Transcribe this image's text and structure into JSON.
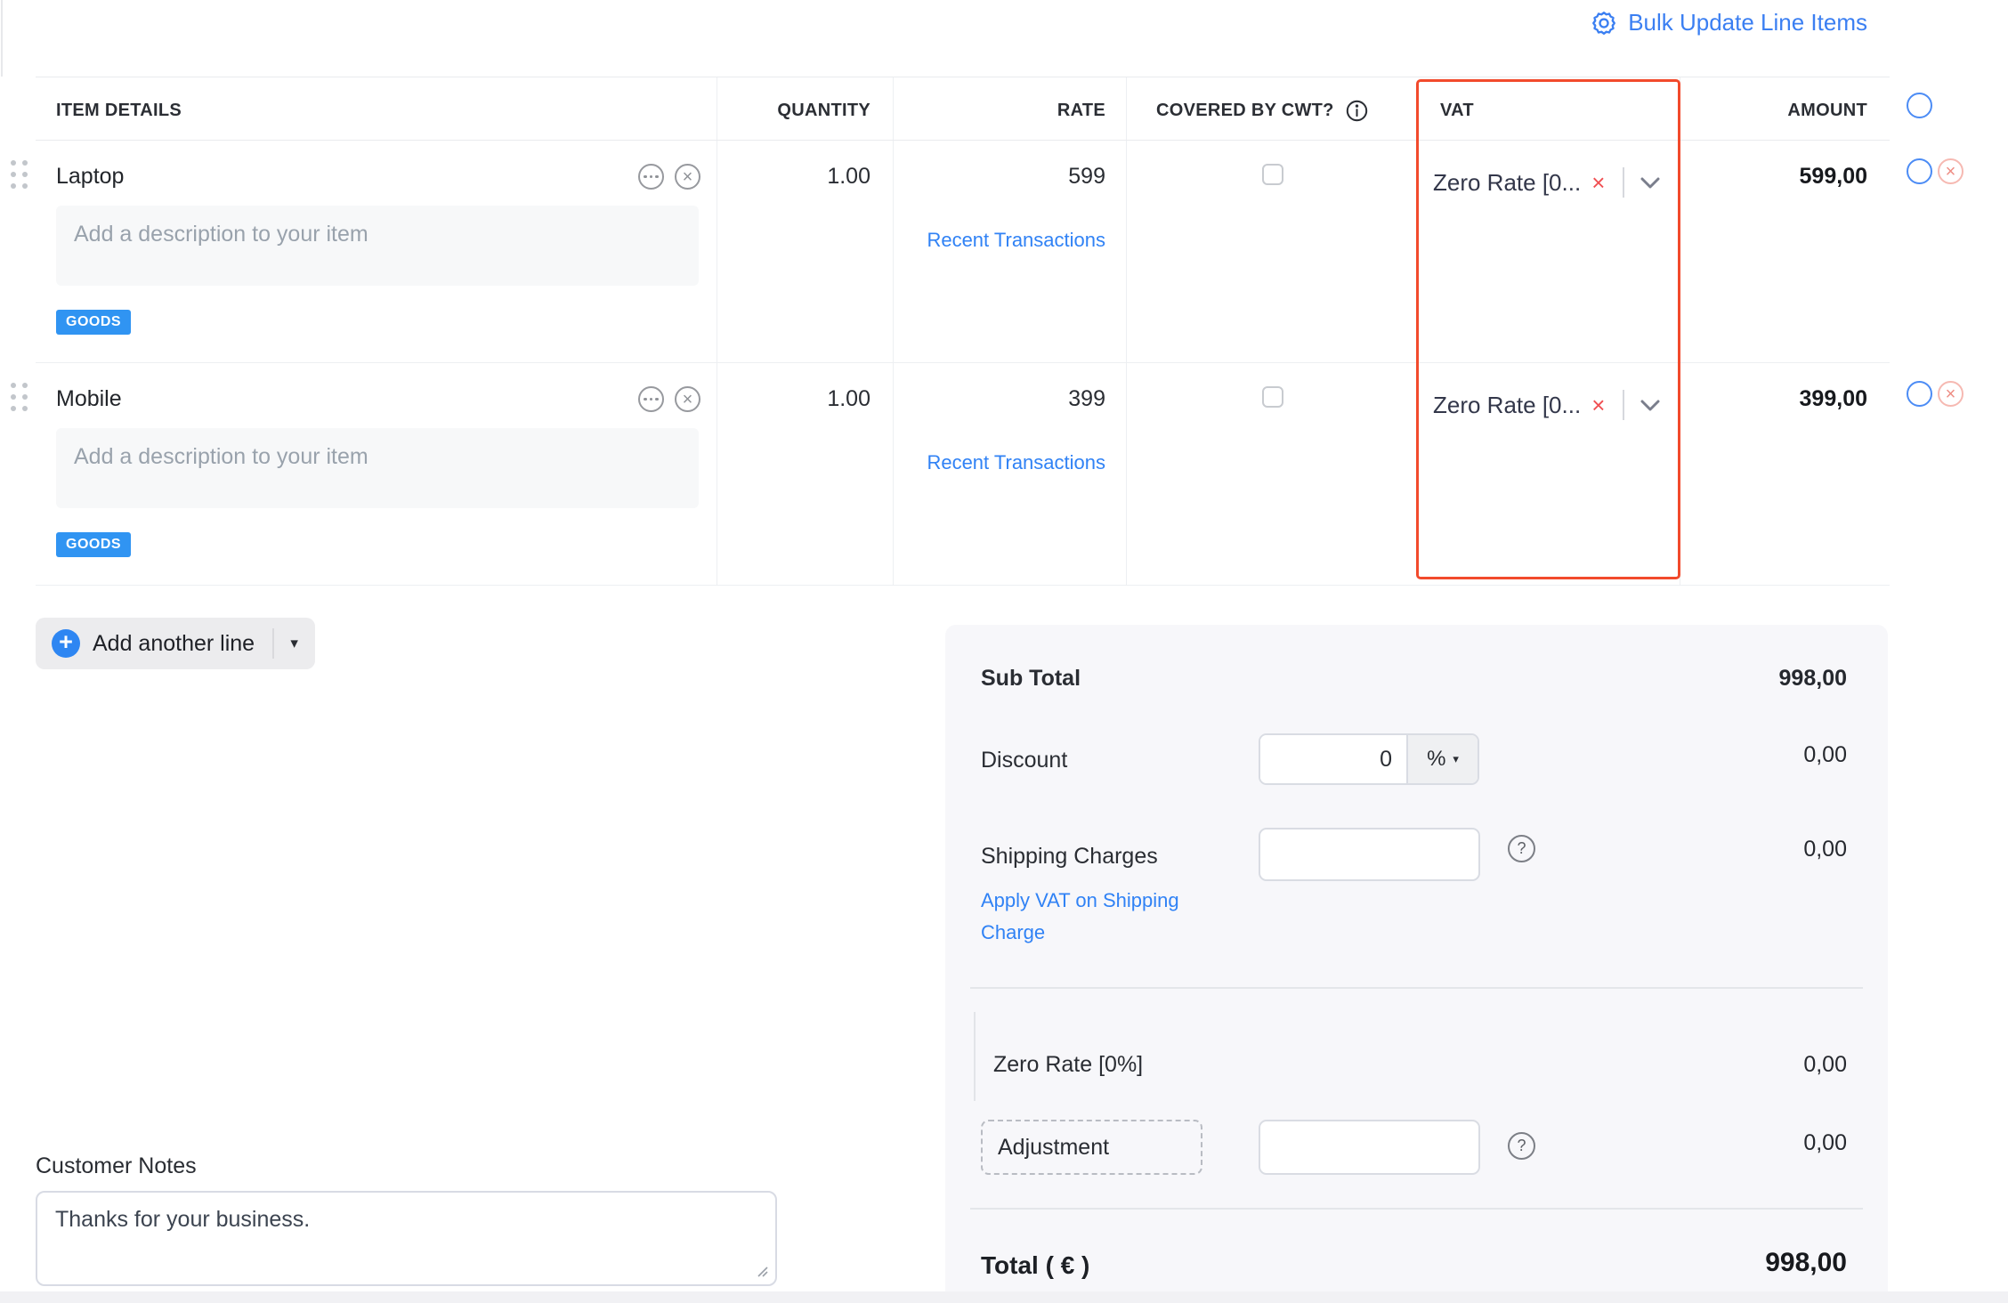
{
  "toolbar": {
    "bulk_update_label": "Bulk Update Line Items"
  },
  "table": {
    "headers": {
      "item_details": "ITEM DETAILS",
      "quantity": "QUANTITY",
      "rate": "RATE",
      "covered_by_cwt": "COVERED BY CWT?",
      "vat": "VAT",
      "amount": "AMOUNT"
    },
    "rows": [
      {
        "name": "Laptop",
        "description_placeholder": "Add a description to your item",
        "type_badge": "GOODS",
        "quantity": "1.00",
        "rate": "599",
        "recent_transactions_label": "Recent Transactions",
        "cwt_checked": false,
        "vat_display": "Zero Rate [0...",
        "amount": "599,00"
      },
      {
        "name": "Mobile",
        "description_placeholder": "Add a description to your item",
        "type_badge": "GOODS",
        "quantity": "1.00",
        "rate": "399",
        "recent_transactions_label": "Recent Transactions",
        "cwt_checked": false,
        "vat_display": "Zero Rate [0...",
        "amount": "399,00"
      }
    ]
  },
  "actions": {
    "add_line_label": "Add another line"
  },
  "summary": {
    "sub_total_label": "Sub Total",
    "sub_total_amount": "998,00",
    "discount_label": "Discount",
    "discount_value": "0",
    "discount_unit": "%",
    "discount_amount": "0,00",
    "shipping_label": "Shipping Charges",
    "shipping_link_label": "Apply VAT on Shipping Charge",
    "shipping_amount": "0,00",
    "tax_row_label": "Zero Rate [0%]",
    "tax_row_amount": "0,00",
    "adjustment_label": "Adjustment",
    "adjustment_amount": "0,00",
    "total_label": "Total ( € )",
    "total_amount": "998,00"
  },
  "notes": {
    "label": "Customer Notes",
    "value": "Thanks for your business."
  },
  "icons": {
    "gear": "gear-icon",
    "plus_glyph": "+",
    "close_glyph": "×",
    "question_glyph": "?",
    "caret_glyph": "▾"
  },
  "colors": {
    "accent_blue": "#3b7ff2",
    "badge_blue": "#3094f2",
    "link_blue": "#3082f5",
    "highlight_red": "#f24a2c",
    "chip_x_red": "#f04f52",
    "summary_bg": "#f7f7fa"
  }
}
